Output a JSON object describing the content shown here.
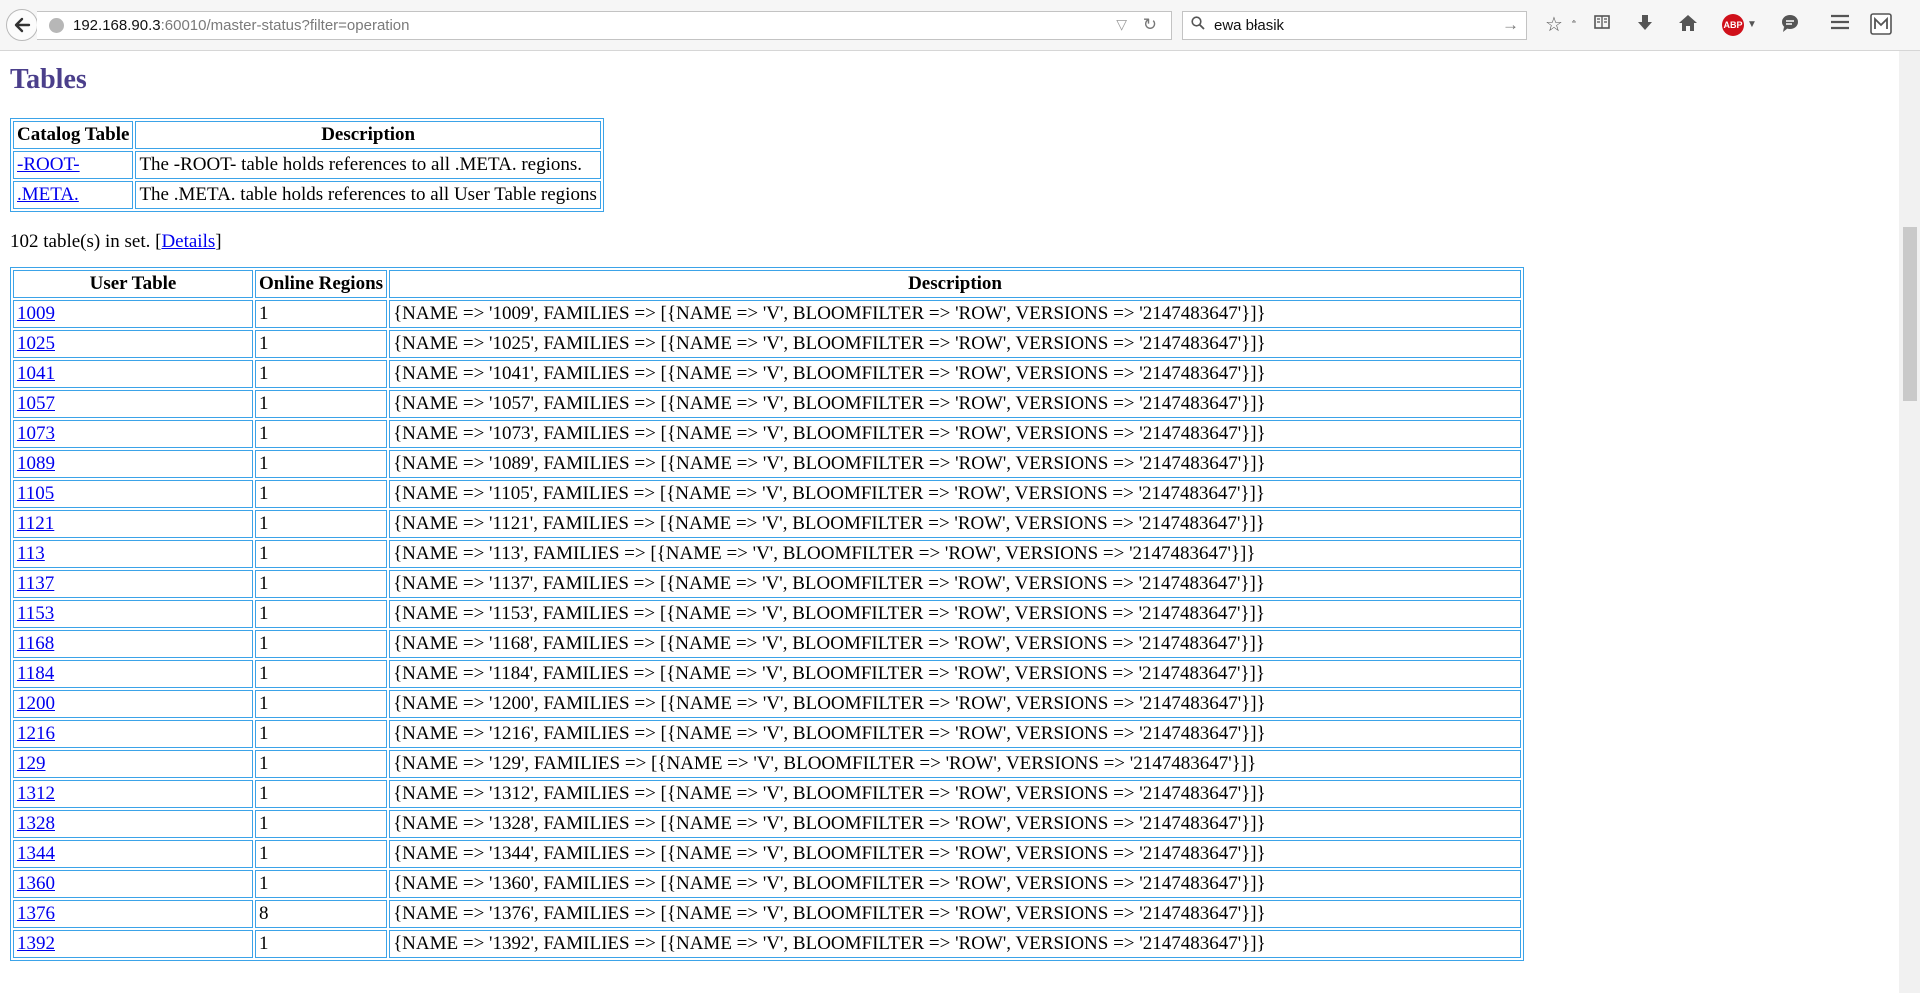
{
  "browser": {
    "url_host": "192.168.90.3",
    "url_rest": ":60010/master-status?filter=operation",
    "search_text": "ewa błasik",
    "abp_label": "ABP"
  },
  "page": {
    "title": "Tables",
    "catalog": {
      "headers": [
        "Catalog Table",
        "Description"
      ],
      "rows": [
        {
          "name": "-ROOT-",
          "description": "The -ROOT- table holds references to all .META. regions."
        },
        {
          "name": ".META.",
          "description": "The .META. table holds references to all User Table regions"
        }
      ]
    },
    "set_text_prefix": "102 table(s) in set. [",
    "set_link": "Details",
    "set_text_suffix": "]",
    "user_tables": {
      "headers": [
        "User Table",
        "Online Regions",
        "Description"
      ],
      "rows": [
        {
          "name": "1009",
          "regions": "1",
          "description": "{NAME => '1009', FAMILIES => [{NAME => 'V', BLOOMFILTER => 'ROW', VERSIONS => '2147483647'}]}"
        },
        {
          "name": "1025",
          "regions": "1",
          "description": "{NAME => '1025', FAMILIES => [{NAME => 'V', BLOOMFILTER => 'ROW', VERSIONS => '2147483647'}]}"
        },
        {
          "name": "1041",
          "regions": "1",
          "description": "{NAME => '1041', FAMILIES => [{NAME => 'V', BLOOMFILTER => 'ROW', VERSIONS => '2147483647'}]}"
        },
        {
          "name": "1057",
          "regions": "1",
          "description": "{NAME => '1057', FAMILIES => [{NAME => 'V', BLOOMFILTER => 'ROW', VERSIONS => '2147483647'}]}"
        },
        {
          "name": "1073",
          "regions": "1",
          "description": "{NAME => '1073', FAMILIES => [{NAME => 'V', BLOOMFILTER => 'ROW', VERSIONS => '2147483647'}]}"
        },
        {
          "name": "1089",
          "regions": "1",
          "description": "{NAME => '1089', FAMILIES => [{NAME => 'V', BLOOMFILTER => 'ROW', VERSIONS => '2147483647'}]}"
        },
        {
          "name": "1105",
          "regions": "1",
          "description": "{NAME => '1105', FAMILIES => [{NAME => 'V', BLOOMFILTER => 'ROW', VERSIONS => '2147483647'}]}"
        },
        {
          "name": "1121",
          "regions": "1",
          "description": "{NAME => '1121', FAMILIES => [{NAME => 'V', BLOOMFILTER => 'ROW', VERSIONS => '2147483647'}]}"
        },
        {
          "name": "113",
          "regions": "1",
          "description": "{NAME => '113', FAMILIES => [{NAME => 'V', BLOOMFILTER => 'ROW', VERSIONS => '2147483647'}]}"
        },
        {
          "name": "1137",
          "regions": "1",
          "description": "{NAME => '1137', FAMILIES => [{NAME => 'V', BLOOMFILTER => 'ROW', VERSIONS => '2147483647'}]}"
        },
        {
          "name": "1153",
          "regions": "1",
          "description": "{NAME => '1153', FAMILIES => [{NAME => 'V', BLOOMFILTER => 'ROW', VERSIONS => '2147483647'}]}"
        },
        {
          "name": "1168",
          "regions": "1",
          "description": "{NAME => '1168', FAMILIES => [{NAME => 'V', BLOOMFILTER => 'ROW', VERSIONS => '2147483647'}]}"
        },
        {
          "name": "1184",
          "regions": "1",
          "description": "{NAME => '1184', FAMILIES => [{NAME => 'V', BLOOMFILTER => 'ROW', VERSIONS => '2147483647'}]}"
        },
        {
          "name": "1200",
          "regions": "1",
          "description": "{NAME => '1200', FAMILIES => [{NAME => 'V', BLOOMFILTER => 'ROW', VERSIONS => '2147483647'}]}"
        },
        {
          "name": "1216",
          "regions": "1",
          "description": "{NAME => '1216', FAMILIES => [{NAME => 'V', BLOOMFILTER => 'ROW', VERSIONS => '2147483647'}]}"
        },
        {
          "name": "129",
          "regions": "1",
          "description": "{NAME => '129', FAMILIES => [{NAME => 'V', BLOOMFILTER => 'ROW', VERSIONS => '2147483647'}]}"
        },
        {
          "name": "1312",
          "regions": "1",
          "description": "{NAME => '1312', FAMILIES => [{NAME => 'V', BLOOMFILTER => 'ROW', VERSIONS => '2147483647'}]}"
        },
        {
          "name": "1328",
          "regions": "1",
          "description": "{NAME => '1328', FAMILIES => [{NAME => 'V', BLOOMFILTER => 'ROW', VERSIONS => '2147483647'}]}"
        },
        {
          "name": "1344",
          "regions": "1",
          "description": "{NAME => '1344', FAMILIES => [{NAME => 'V', BLOOMFILTER => 'ROW', VERSIONS => '2147483647'}]}"
        },
        {
          "name": "1360",
          "regions": "1",
          "description": "{NAME => '1360', FAMILIES => [{NAME => 'V', BLOOMFILTER => 'ROW', VERSIONS => '2147483647'}]}"
        },
        {
          "name": "1376",
          "regions": "8",
          "description": "{NAME => '1376', FAMILIES => [{NAME => 'V', BLOOMFILTER => 'ROW', VERSIONS => '2147483647'}]}"
        },
        {
          "name": "1392",
          "regions": "1",
          "description": "{NAME => '1392', FAMILIES => [{NAME => 'V', BLOOMFILTER => 'ROW', VERSIONS => '2147483647'}]}"
        }
      ]
    }
  }
}
